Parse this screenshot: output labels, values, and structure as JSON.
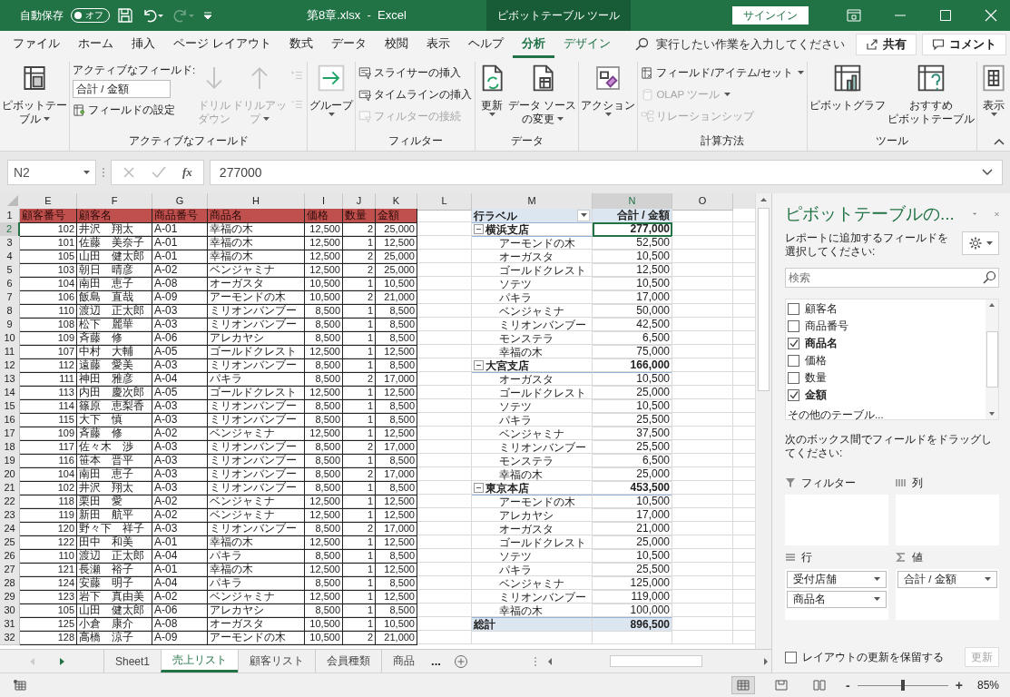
{
  "title_bar": {
    "autosave_label": "自動保存",
    "autosave": {
      "label": "オフ",
      "on": false
    },
    "redo_disabled": true,
    "filename": "第8章.xlsx  -  Excel",
    "context_tab": "ピボットテーブル ツール",
    "sign_in": "サインイン"
  },
  "ribbon": {
    "tabs": [
      {
        "label": "ファイル",
        "selected": false,
        "contextual": false
      },
      {
        "label": "ホーム",
        "selected": false,
        "contextual": false
      },
      {
        "label": "挿入",
        "selected": false,
        "contextual": false
      },
      {
        "label": "ページ レイアウト",
        "selected": false,
        "contextual": false
      },
      {
        "label": "数式",
        "selected": false,
        "contextual": false
      },
      {
        "label": "データ",
        "selected": false,
        "contextual": false
      },
      {
        "label": "校閲",
        "selected": false,
        "contextual": false
      },
      {
        "label": "表示",
        "selected": false,
        "contextual": false
      },
      {
        "label": "ヘルプ",
        "selected": false,
        "contextual": false
      },
      {
        "label": "分析",
        "selected": true,
        "contextual": true
      },
      {
        "label": "デザイン",
        "selected": false,
        "contextual": true
      }
    ],
    "tell_me": "実行したい作業を入力してください",
    "share": "共有",
    "comment": "コメント",
    "groups": [
      {
        "columns": [
          {
            "kind": "large",
            "lines": [
              "ピボットテー",
              "ブル"
            ],
            "dropdown": true,
            "disabled": false
          }
        ]
      },
      {
        "label": "アクティブなフィールド",
        "columns": [
          {
            "kind": "stack",
            "items": [
              {
                "kind": "caption",
                "label": "アクティブなフィールド:"
              },
              {
                "kind": "field",
                "value": "合計 / 金額"
              },
              {
                "kind": "small",
                "label": "フィールドの設定",
                "dropdown": false,
                "disabled": false
              }
            ]
          },
          {
            "kind": "large",
            "lines": [
              "ドリル",
              "ダウン"
            ],
            "dropdown": false,
            "disabled": true
          },
          {
            "kind": "large",
            "lines": [
              "ドリルアッ",
              "プ"
            ],
            "dropdown": true,
            "disabled": true
          },
          {
            "kind": "stack",
            "items": [
              {
                "kind": "icon",
                "disabled": true
              },
              {
                "kind": "icon",
                "disabled": true
              }
            ]
          }
        ]
      },
      {
        "columns": [
          {
            "kind": "large",
            "lines": [
              "グループ"
            ],
            "dropdown": true,
            "disabled": false
          }
        ]
      },
      {
        "label": "フィルター",
        "columns": [
          {
            "kind": "stack",
            "items": [
              {
                "kind": "small",
                "label": "スライサーの挿入",
                "dropdown": false,
                "disabled": false
              },
              {
                "kind": "small",
                "label": "タイムラインの挿入",
                "dropdown": false,
                "disabled": false
              },
              {
                "kind": "small",
                "label": "フィルターの接続",
                "dropdown": false,
                "disabled": true
              }
            ]
          }
        ]
      },
      {
        "label": "データ",
        "columns": [
          {
            "kind": "large",
            "lines": [
              "更新"
            ],
            "dropdown": true,
            "disabled": false
          },
          {
            "kind": "large",
            "lines": [
              "データ ソース",
              "の変更"
            ],
            "dropdown": true,
            "disabled": false
          }
        ]
      },
      {
        "columns": [
          {
            "kind": "large",
            "lines": [
              "アクション"
            ],
            "dropdown": true,
            "disabled": false
          }
        ]
      },
      {
        "label": "計算方法",
        "columns": [
          {
            "kind": "stack",
            "items": [
              {
                "kind": "small",
                "label": "フィールド/アイテム/セット",
                "dropdown": true,
                "disabled": false
              },
              {
                "kind": "small",
                "label": "OLAP ツール",
                "dropdown": true,
                "disabled": true
              },
              {
                "kind": "small",
                "label": "リレーションシップ",
                "dropdown": false,
                "disabled": true
              }
            ]
          }
        ]
      },
      {
        "label": "ツール",
        "columns": [
          {
            "kind": "large",
            "lines": [
              "ピボットグラフ"
            ],
            "dropdown": false,
            "disabled": false
          },
          {
            "kind": "large",
            "lines": [
              "おすすめ",
              "ピボットテーブル"
            ],
            "dropdown": false,
            "disabled": false
          }
        ]
      },
      {
        "columns": [
          {
            "kind": "large",
            "lines": [
              "表示"
            ],
            "dropdown": true,
            "disabled": false
          }
        ]
      }
    ]
  },
  "formula_bar": {
    "name_box": "N2",
    "function_label": "fx",
    "formula": "277000"
  },
  "sheet": {
    "columns": [
      {
        "label": "E",
        "selected": false
      },
      {
        "label": "F",
        "selected": false
      },
      {
        "label": "G",
        "selected": false
      },
      {
        "label": "H",
        "selected": false
      },
      {
        "label": "I",
        "selected": false
      },
      {
        "label": "J",
        "selected": false
      },
      {
        "label": "K",
        "selected": false
      },
      {
        "label": "L",
        "selected": false
      },
      {
        "label": "M",
        "selected": false
      },
      {
        "label": "N",
        "selected": true
      },
      {
        "label": "O",
        "selected": false
      }
    ],
    "row_headers": [
      {
        "label": "1",
        "selected": false
      },
      {
        "label": "2",
        "selected": true
      },
      {
        "label": "3",
        "selected": false
      },
      {
        "label": "4",
        "selected": false
      },
      {
        "label": "5",
        "selected": false
      },
      {
        "label": "6",
        "selected": false
      },
      {
        "label": "7",
        "selected": false
      },
      {
        "label": "8",
        "selected": false
      },
      {
        "label": "9",
        "selected": false
      },
      {
        "label": "10",
        "selected": false
      },
      {
        "label": "11",
        "selected": false
      },
      {
        "label": "12",
        "selected": false
      },
      {
        "label": "13",
        "selected": false
      },
      {
        "label": "14",
        "selected": false
      },
      {
        "label": "15",
        "selected": false
      },
      {
        "label": "16",
        "selected": false
      },
      {
        "label": "17",
        "selected": false
      },
      {
        "label": "18",
        "selected": false
      },
      {
        "label": "19",
        "selected": false
      },
      {
        "label": "20",
        "selected": false
      },
      {
        "label": "21",
        "selected": false
      },
      {
        "label": "22",
        "selected": false
      },
      {
        "label": "23",
        "selected": false
      },
      {
        "label": "24",
        "selected": false
      },
      {
        "label": "25",
        "selected": false
      },
      {
        "label": "26",
        "selected": false
      },
      {
        "label": "27",
        "selected": false
      },
      {
        "label": "28",
        "selected": false
      },
      {
        "label": "29",
        "selected": false
      },
      {
        "label": "30",
        "selected": false
      },
      {
        "label": "31",
        "selected": false
      },
      {
        "label": "32",
        "selected": false
      }
    ]
  },
  "table": {
    "columns": [
      "顧客番号",
      "顧客名",
      "商品番号",
      "商品名",
      "価格",
      "数量",
      "金額"
    ],
    "rows": [
      [
        "102",
        "井沢　翔太",
        "A-01",
        "幸福の木",
        "12,500",
        "2",
        "25,000"
      ],
      [
        "101",
        "佐藤　美奈子",
        "A-01",
        "幸福の木",
        "12,500",
        "1",
        "12,500"
      ],
      [
        "105",
        "山田　健太郎",
        "A-01",
        "幸福の木",
        "12,500",
        "2",
        "25,000"
      ],
      [
        "103",
        "朝日　晴彦",
        "A-02",
        "ベンジャミナ",
        "12,500",
        "2",
        "25,000"
      ],
      [
        "104",
        "南田　恵子",
        "A-08",
        "オーガスタ",
        "10,500",
        "1",
        "10,500"
      ],
      [
        "106",
        "飯島　直哉",
        "A-09",
        "アーモンドの木",
        "10,500",
        "2",
        "21,000"
      ],
      [
        "110",
        "渡辺　正太郎",
        "A-03",
        "ミリオンバンブー",
        "8,500",
        "1",
        "8,500"
      ],
      [
        "108",
        "松下　麗華",
        "A-03",
        "ミリオンバンブー",
        "8,500",
        "1",
        "8,500"
      ],
      [
        "109",
        "斉藤　修",
        "A-06",
        "アレカヤシ",
        "8,500",
        "1",
        "8,500"
      ],
      [
        "107",
        "中村　大輔",
        "A-05",
        "ゴールドクレスト",
        "12,500",
        "1",
        "12,500"
      ],
      [
        "112",
        "遠藤　愛美",
        "A-03",
        "ミリオンバンブー",
        "8,500",
        "1",
        "8,500"
      ],
      [
        "111",
        "神田　雅彦",
        "A-04",
        "パキラ",
        "8,500",
        "2",
        "17,000"
      ],
      [
        "113",
        "内田　慶次郎",
        "A-05",
        "ゴールドクレスト",
        "12,500",
        "1",
        "12,500"
      ],
      [
        "114",
        "篠原　恵梨香",
        "A-03",
        "ミリオンバンブー",
        "8,500",
        "1",
        "8,500"
      ],
      [
        "115",
        "大下　慎",
        "A-03",
        "ミリオンバンブー",
        "8,500",
        "1",
        "8,500"
      ],
      [
        "109",
        "斉藤　修",
        "A-02",
        "ベンジャミナ",
        "12,500",
        "1",
        "12,500"
      ],
      [
        "117",
        "佐々木　渉",
        "A-03",
        "ミリオンバンブー",
        "8,500",
        "2",
        "17,000"
      ],
      [
        "116",
        "笹本　晋平",
        "A-03",
        "ミリオンバンブー",
        "8,500",
        "1",
        "8,500"
      ],
      [
        "104",
        "南田　恵子",
        "A-03",
        "ミリオンバンブー",
        "8,500",
        "2",
        "17,000"
      ],
      [
        "102",
        "井沢　翔太",
        "A-03",
        "ミリオンバンブー",
        "8,500",
        "1",
        "8,500"
      ],
      [
        "118",
        "栗田　愛",
        "A-02",
        "ベンジャミナ",
        "12,500",
        "1",
        "12,500"
      ],
      [
        "119",
        "新田　航平",
        "A-02",
        "ベンジャミナ",
        "12,500",
        "1",
        "12,500"
      ],
      [
        "120",
        "野々下　祥子",
        "A-03",
        "ミリオンバンブー",
        "8,500",
        "2",
        "17,000"
      ],
      [
        "122",
        "田中　和美",
        "A-01",
        "幸福の木",
        "12,500",
        "1",
        "12,500"
      ],
      [
        "110",
        "渡辺　正太郎",
        "A-04",
        "パキラ",
        "8,500",
        "1",
        "8,500"
      ],
      [
        "121",
        "長瀬　裕子",
        "A-01",
        "幸福の木",
        "12,500",
        "1",
        "12,500"
      ],
      [
        "124",
        "安藤　明子",
        "A-04",
        "パキラ",
        "8,500",
        "1",
        "8,500"
      ],
      [
        "123",
        "岩下　真由美",
        "A-02",
        "ベンジャミナ",
        "12,500",
        "1",
        "12,500"
      ],
      [
        "105",
        "山田　健太郎",
        "A-06",
        "アレカヤシ",
        "8,500",
        "1",
        "8,500"
      ],
      [
        "125",
        "小倉　康介",
        "A-08",
        "オーガスタ",
        "10,500",
        "1",
        "10,500"
      ],
      [
        "128",
        "高橋　涼子",
        "A-09",
        "アーモンドの木",
        "10,500",
        "2",
        "21,000"
      ]
    ]
  },
  "pivot": {
    "row_label": "行ラベル",
    "value_label": "合計 / 金額",
    "groups": [
      {
        "label": "横浜支店",
        "total": "277,000",
        "expanded": true,
        "selected": true,
        "items": [
          {
            "label": "アーモンドの木",
            "value": "52,500"
          },
          {
            "label": "オーガスタ",
            "value": "10,500"
          },
          {
            "label": "ゴールドクレスト",
            "value": "12,500"
          },
          {
            "label": "ソテツ",
            "value": "10,500"
          },
          {
            "label": "パキラ",
            "value": "17,000"
          },
          {
            "label": "ベンジャミナ",
            "value": "50,000"
          },
          {
            "label": "ミリオンバンブー",
            "value": "42,500"
          },
          {
            "label": "モンステラ",
            "value": "6,500"
          },
          {
            "label": "幸福の木",
            "value": "75,000"
          }
        ]
      },
      {
        "label": "大宮支店",
        "total": "166,000",
        "expanded": true,
        "selected": false,
        "items": [
          {
            "label": "オーガスタ",
            "value": "10,500"
          },
          {
            "label": "ゴールドクレスト",
            "value": "25,000"
          },
          {
            "label": "ソテツ",
            "value": "10,500"
          },
          {
            "label": "パキラ",
            "value": "25,500"
          },
          {
            "label": "ベンジャミナ",
            "value": "37,500"
          },
          {
            "label": "ミリオンバンブー",
            "value": "25,500"
          },
          {
            "label": "モンステラ",
            "value": "6,500"
          },
          {
            "label": "幸福の木",
            "value": "25,000"
          }
        ]
      },
      {
        "label": "東京本店",
        "total": "453,500",
        "expanded": true,
        "selected": false,
        "items": [
          {
            "label": "アーモンドの木",
            "value": "10,500"
          },
          {
            "label": "アレカヤシ",
            "value": "17,000"
          },
          {
            "label": "オーガスタ",
            "value": "21,000"
          },
          {
            "label": "ゴールドクレスト",
            "value": "25,000"
          },
          {
            "label": "ソテツ",
            "value": "10,500"
          },
          {
            "label": "パキラ",
            "value": "25,500"
          },
          {
            "label": "ベンジャミナ",
            "value": "125,000"
          },
          {
            "label": "ミリオンバンブー",
            "value": "119,000"
          },
          {
            "label": "幸福の木",
            "value": "100,000"
          }
        ]
      }
    ],
    "grand_total": {
      "label": "総計",
      "value": "896,500"
    }
  },
  "sheet_tabs": {
    "tabs": [
      {
        "label": "Sheet1",
        "selected": false
      },
      {
        "label": "売上リスト",
        "selected": true
      },
      {
        "label": "顧客リスト",
        "selected": false
      },
      {
        "label": "会員種類",
        "selected": false
      },
      {
        "label": "商品",
        "selected": false
      }
    ],
    "more": "..."
  },
  "field_pane": {
    "title": "ピボットテーブルの...",
    "instruction": "レポートに追加するフィールドを選択してください:",
    "search_placeholder": "検索",
    "fields": [
      {
        "label": "顧客名",
        "checked": false
      },
      {
        "label": "商品番号",
        "checked": false
      },
      {
        "label": "商品名",
        "checked": true
      },
      {
        "label": "価格",
        "checked": false
      },
      {
        "label": "数量",
        "checked": false
      },
      {
        "label": "金額",
        "checked": true
      }
    ],
    "more_tables": "その他のテーブル...",
    "drag_hint": "次のボックス間でフィールドをドラッグしてください:",
    "areas": [
      {
        "kind": "filter",
        "label": "フィルター"
      },
      {
        "kind": "columns",
        "label": "列"
      },
      {
        "kind": "rows",
        "label": "行",
        "items": [
          "受付店舗",
          "商品名"
        ]
      },
      {
        "kind": "values",
        "label": "値",
        "items": [
          "合計 / 金額"
        ]
      }
    ],
    "defer": {
      "label": "レイアウトの更新を保留する",
      "checked": false
    },
    "update": {
      "label": "更新",
      "disabled": true
    }
  },
  "status_bar": {
    "views": [
      {
        "selected": true
      },
      {
        "selected": false
      },
      {
        "selected": false
      }
    ],
    "zoom": {
      "minus": "-",
      "plus": "+",
      "level": 0.5,
      "label": "85%"
    }
  }
}
